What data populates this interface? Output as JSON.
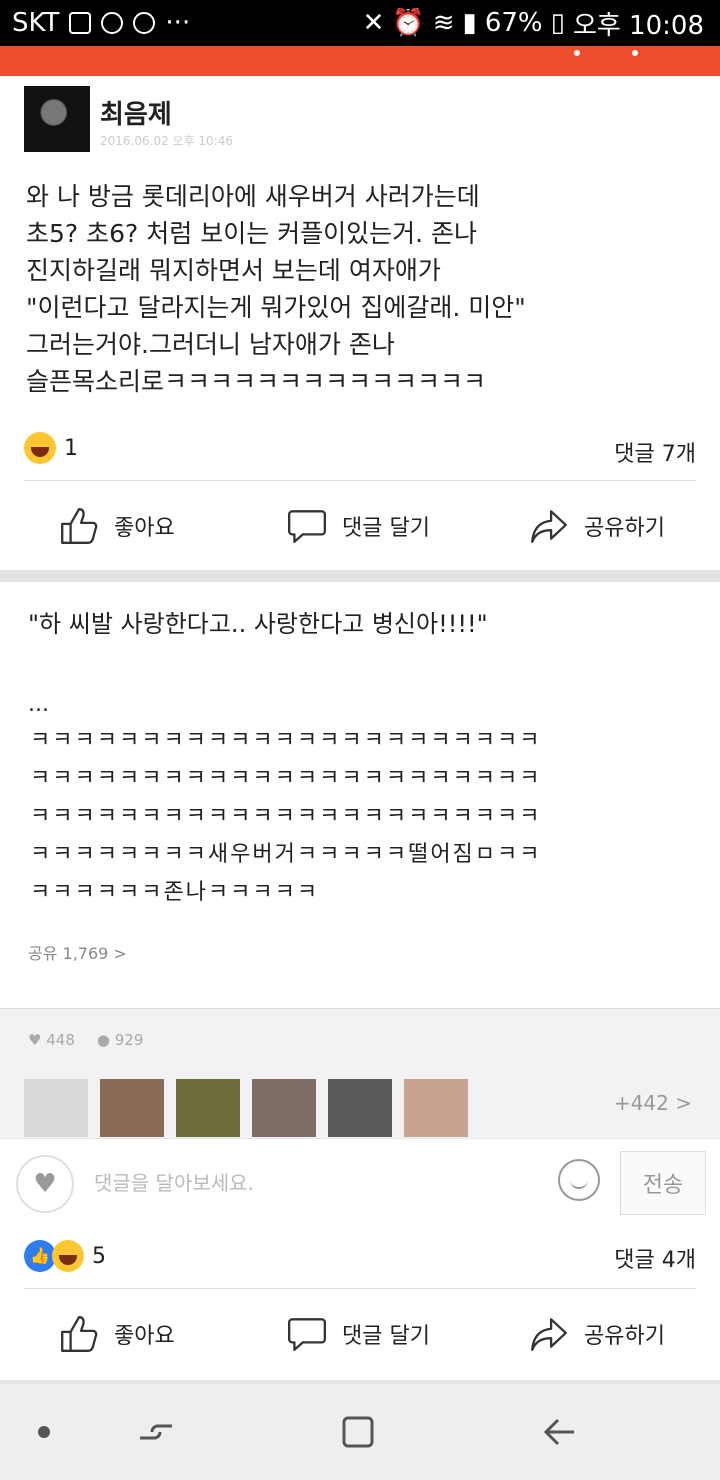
{
  "status_bar": {
    "carrier": "SKT",
    "battery": "67%",
    "time": "오후 10:08"
  },
  "post": {
    "author": "최음제",
    "timestamp": "2016.06.02 오후 10:46",
    "text": "와 나 방금 롯데리아에 새우버거 사러가는데\n초5? 초6? 처럼 보이는 커플이있는거. 존나\n진지하길래 뭐지하면서 보는데 여자애가\n\"이런다고 달라지는게 뭐가있어 집에갈래. 미안\"\n그러는거야.그러더니 남자애가 존나\n슬픈목소리로ㅋㅋㅋㅋㅋㅋㅋㅋㅋㅋㅋㅋㅋㅋ",
    "reaction_count": "1",
    "comment_count": "댓글 7개"
  },
  "actions": {
    "like": "좋아요",
    "comment": "댓글 달기",
    "share": "공유하기"
  },
  "screenshot": {
    "quote": "\"하 씨발 사랑한다고.. 사랑한다고 병신아!!!!\"",
    "ellipsis": "...",
    "laugh_text": "ㅋㅋㅋㅋㅋㅋㅋㅋㅋㅋㅋㅋㅋㅋㅋㅋㅋㅋㅋㅋㅋㅋㅋ\nㅋㅋㅋㅋㅋㅋㅋㅋㅋㅋㅋㅋㅋㅋㅋㅋㅋㅋㅋㅋㅋㅋㅋ\nㅋㅋㅋㅋㅋㅋㅋㅋㅋㅋㅋㅋㅋㅋㅋㅋㅋㅋㅋㅋㅋㅋㅋ\nㅋㅋㅋㅋㅋㅋㅋㅋ새우버거ㅋㅋㅋㅋㅋ떨어짐ㅁㅋㅋ\nㅋㅋㅋㅋㅋㅋ존나ㅋㅋㅋㅋㅋ",
    "share_line": "공유 1,769 >",
    "likes": "448",
    "comments": "929",
    "more_faces": "+442 >",
    "input_placeholder": "댓글을 달아보세요.",
    "send": "전송"
  },
  "post2": {
    "reaction_count": "5",
    "comment_count": "댓글 4개"
  },
  "colors": {
    "accent_red": "#ec4d2e",
    "like_blue": "#2f7cf0",
    "laugh_yellow": "#fcc733"
  }
}
